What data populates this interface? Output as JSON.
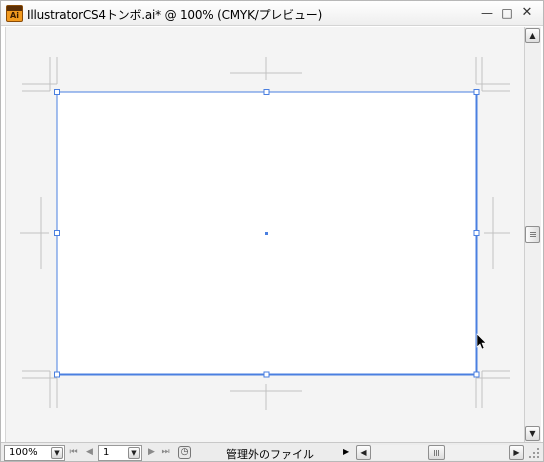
{
  "window": {
    "app_icon_label": "Ai",
    "title": "IllustratorCS4トンボ.ai* @ 100% (CMYK/プレビュー)",
    "controls": {
      "minimize": "—",
      "maximize": "□",
      "close": "✕"
    }
  },
  "canvas": {
    "background_color": "#f4f4f4",
    "selection_color": "#4a7fe0",
    "crop_mark_color": "#c0c0c0"
  },
  "scrollbars": {
    "up": "▲",
    "down": "▼",
    "left": "◀",
    "right": "▶"
  },
  "statusbar": {
    "zoom_value": "100%",
    "dropdown_arrow": "▼",
    "first": "⏮",
    "prev": "◀",
    "artboard_value": "1",
    "next": "▶",
    "last": "⏭",
    "status_text": "管理外のファイル",
    "status_menu_arrow": "▶"
  }
}
